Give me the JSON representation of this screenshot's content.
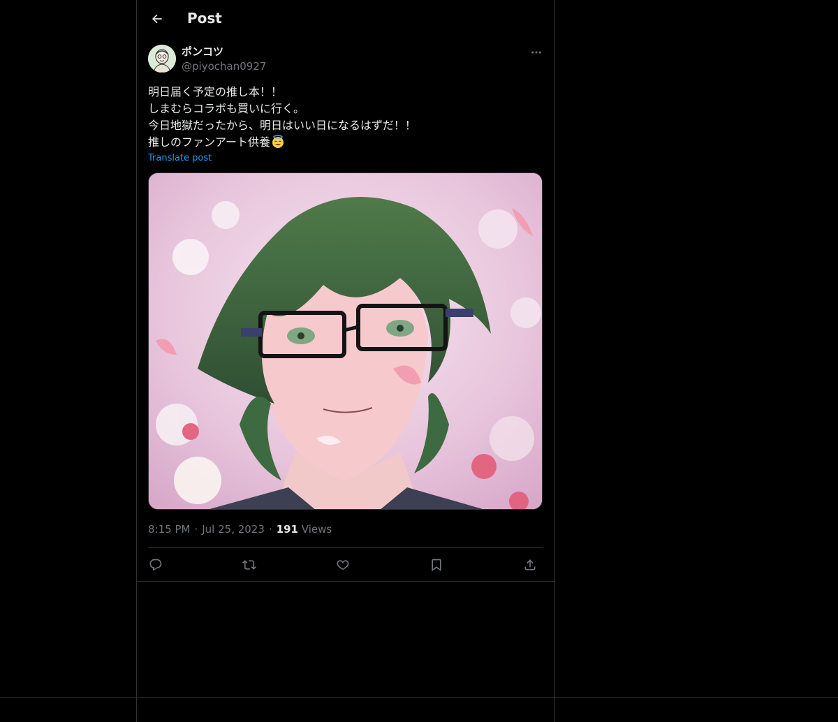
{
  "header": {
    "title": "Post",
    "back_icon": "arrow-left-icon"
  },
  "post": {
    "author": {
      "display_name": "ポンコツ",
      "handle": "@piyochan0927",
      "avatar_icon": "avatar-portrait"
    },
    "text_lines": [
      "明日届く予定の推し本！！",
      "しまむらコラボも買いに行く。",
      "今日地獄だったから、明日はいい日になるはずだ！！",
      "推しのファンアート供養"
    ],
    "emoji": "smiling-face-with-halo",
    "translate_label": "Translate post",
    "media": {
      "description_icon": "anime-portrait-image"
    },
    "meta": {
      "time": "8:15 PM",
      "date": "Jul 25, 2023",
      "views_count": "191",
      "views_label": "Views"
    },
    "actions": {
      "reply_icon": "reply-icon",
      "repost_icon": "repost-icon",
      "like_icon": "heart-icon",
      "bookmark_icon": "bookmark-icon",
      "share_icon": "share-icon"
    }
  },
  "colors": {
    "background": "#000000",
    "text": "#e7e9ea",
    "muted": "#71767b",
    "link": "#1d9bf0",
    "border": "#2f3336"
  }
}
